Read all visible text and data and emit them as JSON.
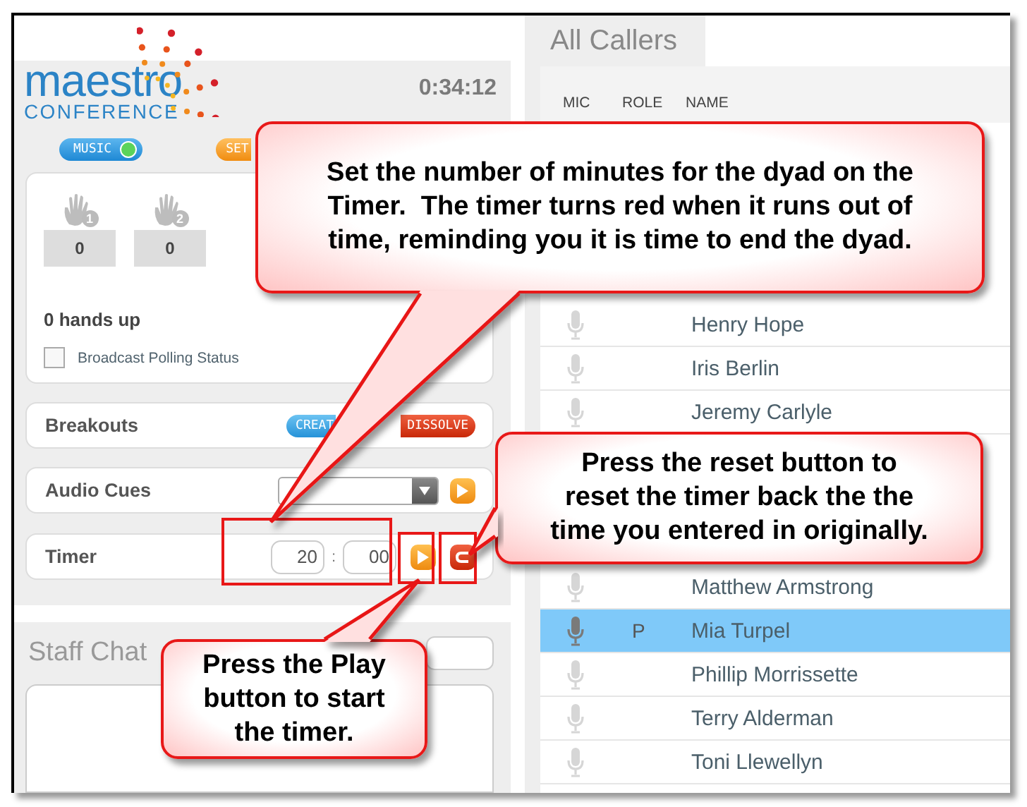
{
  "logo": {
    "name": "maestro",
    "tagline": "CONFERENCE"
  },
  "elapsed": "0:34:12",
  "mode_buttons": [
    {
      "label": "MUSIC",
      "kind": "music",
      "on": true
    },
    {
      "label": "SET",
      "kind": "setting"
    }
  ],
  "hands": [
    {
      "badge": "1",
      "count": "0"
    },
    {
      "badge": "2",
      "count": "0"
    }
  ],
  "hands_up": "0 hands up",
  "broadcast": {
    "label": "Broadcast Polling Status",
    "checked": false
  },
  "controls": [
    {
      "kind": "breakouts",
      "label": "Breakouts",
      "buttons": [
        {
          "label": "CREAT",
          "kind": "create"
        },
        {
          "label": "DISSOLVE",
          "kind": "dissolve"
        }
      ]
    },
    {
      "kind": "audio",
      "label": "Audio Cues"
    },
    {
      "kind": "timer",
      "label": "Timer",
      "minutes": "20",
      "separator": ":",
      "seconds": "00"
    }
  ],
  "staff_chat": {
    "title": "Staff Chat"
  },
  "callers": {
    "tab": "All Callers",
    "columns": [
      "MIC",
      "ROLE",
      "NAME"
    ],
    "row_groups": [
      [
        {
          "name": "Henry Hope",
          "selected": false
        },
        {
          "name": "Iris Berlin",
          "selected": false
        },
        {
          "name": "Jeremy Carlyle",
          "selected": false
        }
      ],
      [
        {
          "name": "Matthew Armstrong",
          "selected": false
        },
        {
          "name": "Mia Turpel",
          "role": "P",
          "selected": true
        },
        {
          "name": "Phillip Morrissette",
          "selected": false
        },
        {
          "name": "Terry Alderman",
          "selected": false
        },
        {
          "name": "Toni Llewellyn",
          "selected": false
        }
      ]
    ]
  },
  "callouts": [
    {
      "kind": "timer-fields",
      "text": "Set the number of minutes for the dyad on the\nTimer.  The timer turns red when it runs out of\ntime, reminding you it is time to end the dyad."
    },
    {
      "kind": "reset",
      "text": "Press the reset button to\nreset the timer back the the\ntime you entered in originally."
    },
    {
      "kind": "play",
      "text": "Press the Play\nbutton to start\nthe timer."
    }
  ]
}
